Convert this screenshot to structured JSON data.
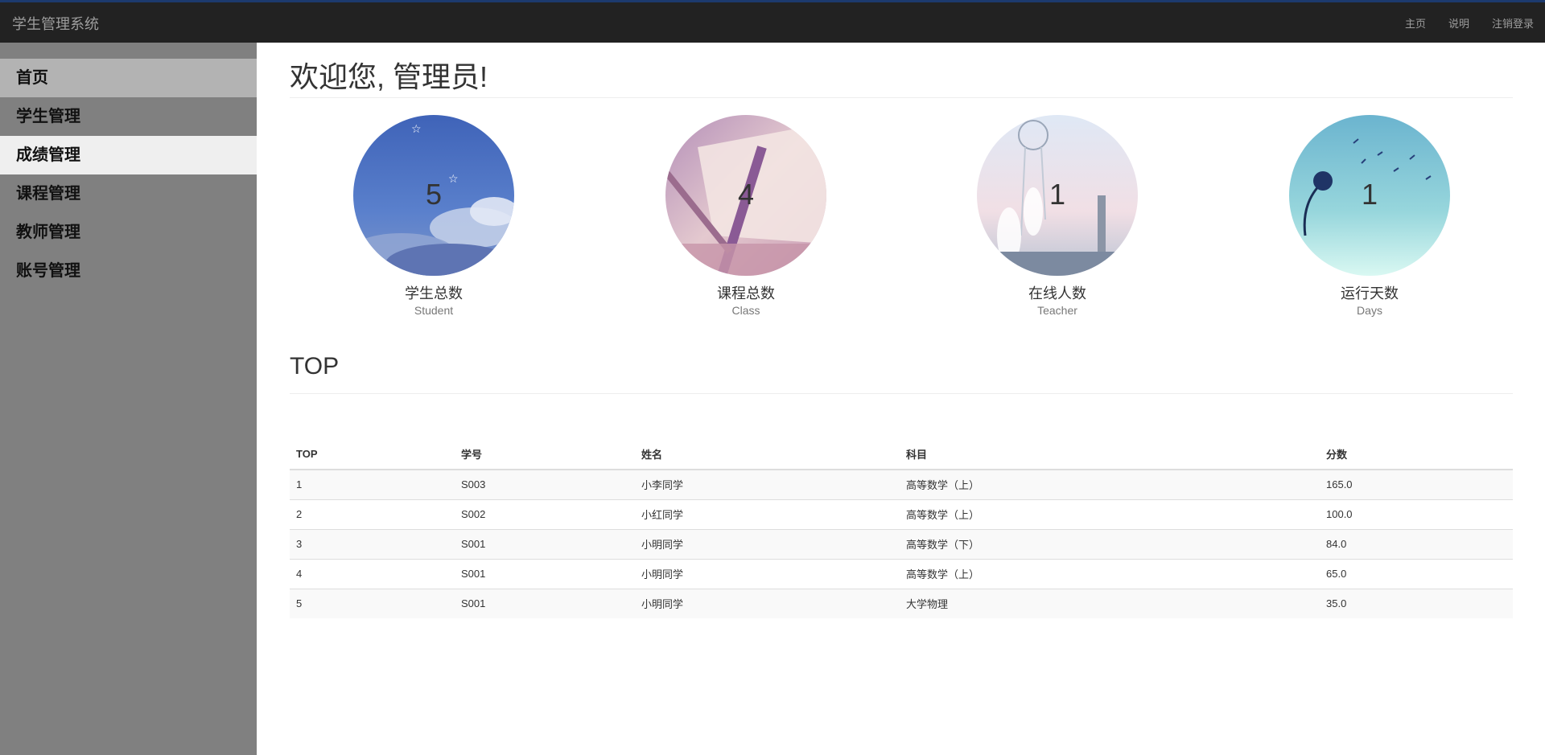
{
  "navbar": {
    "brand": "学生管理系统",
    "links": [
      "主页",
      "说明",
      "注销登录"
    ]
  },
  "sidebar": {
    "items": [
      {
        "label": "首页"
      },
      {
        "label": "学生管理"
      },
      {
        "label": "成绩管理"
      },
      {
        "label": "课程管理"
      },
      {
        "label": "教师管理"
      },
      {
        "label": "账号管理"
      }
    ]
  },
  "main": {
    "welcome": "欢迎您, 管理员!",
    "stats": [
      {
        "value": "5",
        "label": "学生总数",
        "sub": "Student"
      },
      {
        "value": "4",
        "label": "课程总数",
        "sub": "Class"
      },
      {
        "value": "1",
        "label": "在线人数",
        "sub": "Teacher"
      },
      {
        "value": "1",
        "label": "运行天数",
        "sub": "Days"
      }
    ],
    "top_title": "TOP",
    "table": {
      "headers": [
        "TOP",
        "学号",
        "姓名",
        "科目",
        "分数"
      ],
      "rows": [
        [
          "1",
          "S003",
          "小李同学",
          "高等数学（上）",
          "165.0"
        ],
        [
          "2",
          "S002",
          "小红同学",
          "高等数学（上）",
          "100.0"
        ],
        [
          "3",
          "S001",
          "小明同学",
          "高等数学（下）",
          "84.0"
        ],
        [
          "4",
          "S001",
          "小明同学",
          "高等数学（上）",
          "65.0"
        ],
        [
          "5",
          "S001",
          "小明同学",
          "大学物理",
          "35.0"
        ]
      ]
    }
  }
}
